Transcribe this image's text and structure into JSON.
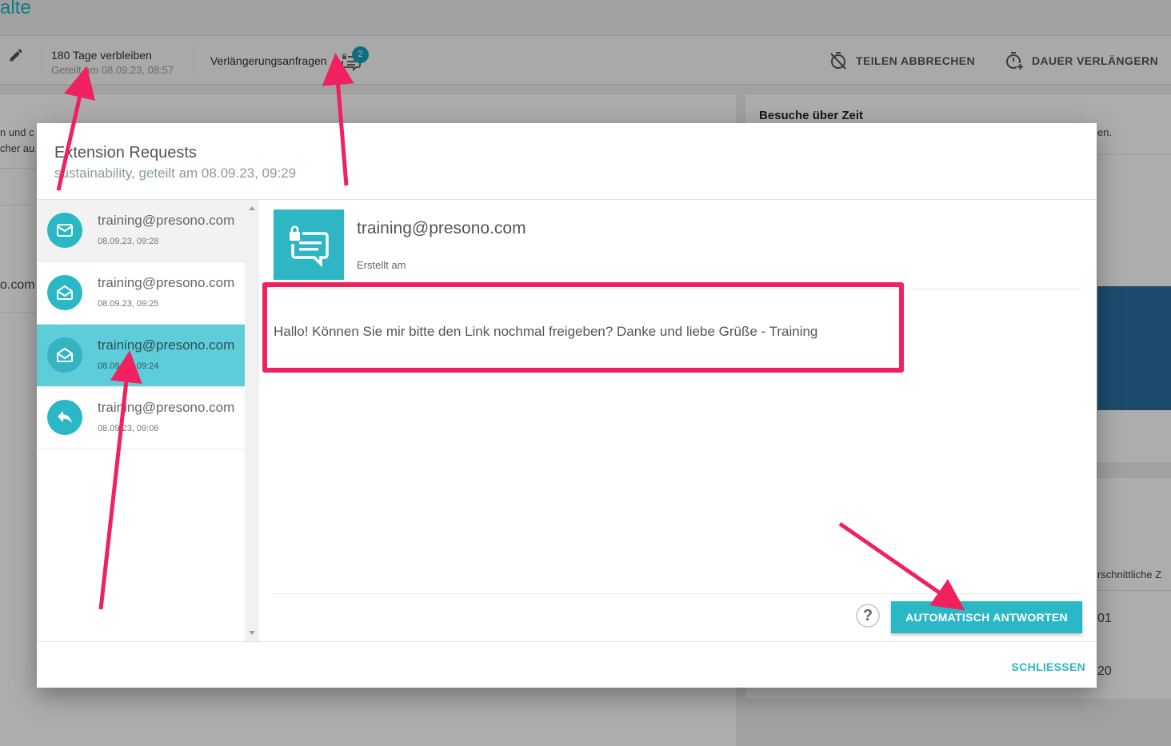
{
  "page": {
    "title": "alte",
    "left_text_1": "n und c",
    "left_text_2": "cher au",
    "left_text_3": "o.com"
  },
  "toolbar": {
    "remaining": "180 Tage verbleiben",
    "shared": "Geteilt am 08.09.23, 08:57",
    "requests_label": "Verlängerungsanfragen",
    "requests_badge": "2",
    "cancel_label": "TEILEN ABBRECHEN",
    "extend_label": "DAUER VERLÄNGERN"
  },
  "right_panel": {
    "title": "Besuche über Zeit",
    "subtitle": "en.",
    "column_label": "rschnittliche Z",
    "value_1": "01",
    "value_2": "20"
  },
  "dialog": {
    "title": "Extension Requests",
    "subtitle": "sustainability, geteilt am 08.09.23, 09:29",
    "requests": [
      {
        "email": "training@presono.com",
        "date": "08.09.23, 09:28",
        "icon": "mail-closed-icon"
      },
      {
        "email": "training@presono.com",
        "date": "08.09.23, 09:25",
        "icon": "mail-open-icon"
      },
      {
        "email": "training@presono.com",
        "date": "08.09.23, 09:24",
        "icon": "mail-open-icon"
      },
      {
        "email": "training@presono.com",
        "date": "08.09.23, 09:06",
        "icon": "reply-icon"
      }
    ],
    "detail": {
      "email": "training@presono.com",
      "created_label": "Erstellt am",
      "message": "Hallo! Können Sie mir bitte den Link nochmal freigeben? Danke und liebe Grüße - Training",
      "help_label": "?",
      "auto_reply_label": "AUTOMATISCH ANTWORTEN"
    },
    "close_label": "SCHLIESSEN"
  },
  "colors": {
    "accent": "#2ab7c6",
    "active_row": "#5ccdd9",
    "annotation": "#f0215e"
  }
}
